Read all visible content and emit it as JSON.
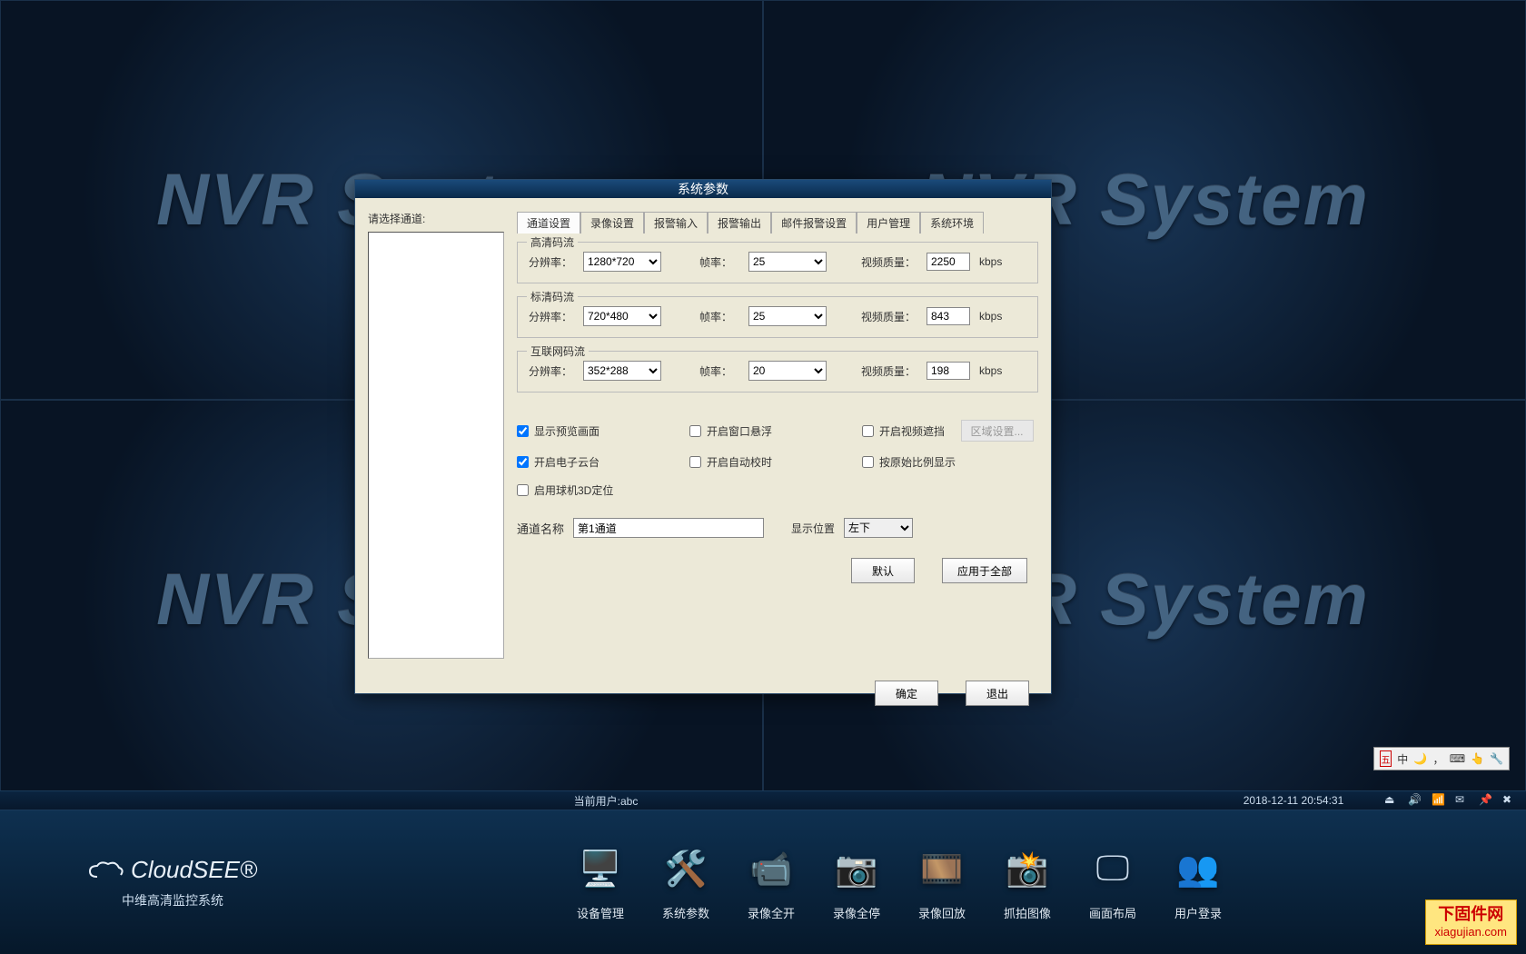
{
  "background_text": "NVR System",
  "dialog": {
    "title": "系统参数",
    "channel_select_label": "请选择通道:",
    "tabs": [
      "通道设置",
      "录像设置",
      "报警输入",
      "报警输出",
      "邮件报警设置",
      "用户管理",
      "系统环境"
    ],
    "active_tab": 0,
    "streams": [
      {
        "legend": "高清码流",
        "res_label": "分辨率：",
        "res": "1280*720",
        "fr_label": "帧率：",
        "fr": "25",
        "vq_label": "视频质量：",
        "vq": "2250",
        "unit": "kbps"
      },
      {
        "legend": "标清码流",
        "res_label": "分辨率：",
        "res": "720*480",
        "fr_label": "帧率：",
        "fr": "25",
        "vq_label": "视频质量：",
        "vq": "843",
        "unit": "kbps"
      },
      {
        "legend": "互联网码流",
        "res_label": "分辨率：",
        "res": "352*288",
        "fr_label": "帧率：",
        "fr": "20",
        "vq_label": "视频质量：",
        "vq": "198",
        "unit": "kbps"
      }
    ],
    "checks": {
      "preview": {
        "label": "显示预览画面",
        "checked": true
      },
      "float": {
        "label": "开启窗口悬浮",
        "checked": false
      },
      "occlude": {
        "label": "开启视频遮挡",
        "checked": false
      },
      "ptz": {
        "label": "开启电子云台",
        "checked": true
      },
      "autotime": {
        "label": "开启自动校时",
        "checked": false
      },
      "ratio": {
        "label": "按原始比例显示",
        "checked": false
      },
      "dome3d": {
        "label": "启用球机3D定位",
        "checked": false
      }
    },
    "region_btn": "区域设置...",
    "channel_name_label": "通道名称",
    "channel_name": "第1通道",
    "position_label": "显示位置",
    "position_value": "左下",
    "btn_default": "默认",
    "btn_apply_all": "应用于全部",
    "btn_ok": "确定",
    "btn_exit": "退出"
  },
  "ime": {
    "wu": "五",
    "zhong": "中"
  },
  "status": {
    "user_label": "当前用户:abc",
    "datetime": "2018-12-11 20:54:31"
  },
  "toolbar": {
    "logo_text": "CloudSEE®",
    "logo_sub": "中维高清监控系统",
    "items": [
      {
        "icon": "🖥️",
        "label": "设备管理",
        "name": "device-manage"
      },
      {
        "icon": "🛠️",
        "label": "系统参数",
        "name": "system-params"
      },
      {
        "icon": "📹",
        "label": "录像全开",
        "name": "record-all-on"
      },
      {
        "icon": "📷",
        "label": "录像全停",
        "name": "record-all-off"
      },
      {
        "icon": "🎞️",
        "label": "录像回放",
        "name": "playback"
      },
      {
        "icon": "📸",
        "label": "抓拍图像",
        "name": "snapshot"
      },
      {
        "icon": "🖵",
        "label": "画面布局",
        "name": "layout"
      },
      {
        "icon": "👥",
        "label": "用户登录",
        "name": "user-login"
      }
    ]
  },
  "watermark": {
    "line1": "下固件网",
    "line2": "xiagujian.com"
  }
}
